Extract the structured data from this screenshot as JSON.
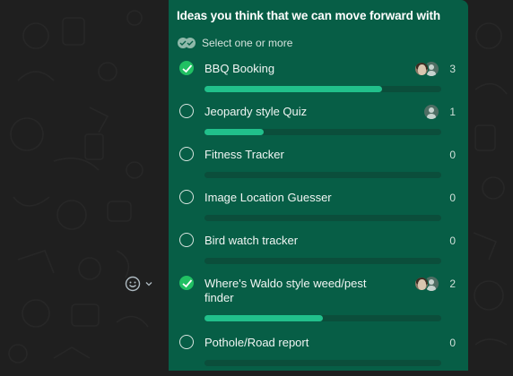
{
  "poll": {
    "question": "Ideas you think that we can move forward with",
    "hint": "Select one or more",
    "options": [
      {
        "label": "BBQ Booking",
        "votes": "3",
        "selected": true,
        "fill": 0.75
      },
      {
        "label": "Jeopardy style Quiz",
        "votes": "1",
        "selected": false,
        "fill": 0.25
      },
      {
        "label": "Fitness Tracker",
        "votes": "0",
        "selected": false,
        "fill": 0
      },
      {
        "label": "Image Location Guesser",
        "votes": "0",
        "selected": false,
        "fill": 0
      },
      {
        "label": "Bird watch tracker",
        "votes": "0",
        "selected": false,
        "fill": 0
      },
      {
        "label": "Where's Waldo style weed/pest finder",
        "votes": "2",
        "selected": true,
        "fill": 0.5
      },
      {
        "label": "Pothole/Road report",
        "votes": "0",
        "selected": false,
        "fill": 0
      }
    ]
  },
  "colors": {
    "card": "#075e46",
    "check": "#21c063",
    "bar_fill": "#21c08b",
    "bar_track": "#0b4e3b",
    "background": "#1f1f1f"
  },
  "icons": {
    "reaction": "emoji-smile-icon",
    "reaction_menu": "chevron-down-icon",
    "hint": "double-check-icon"
  }
}
